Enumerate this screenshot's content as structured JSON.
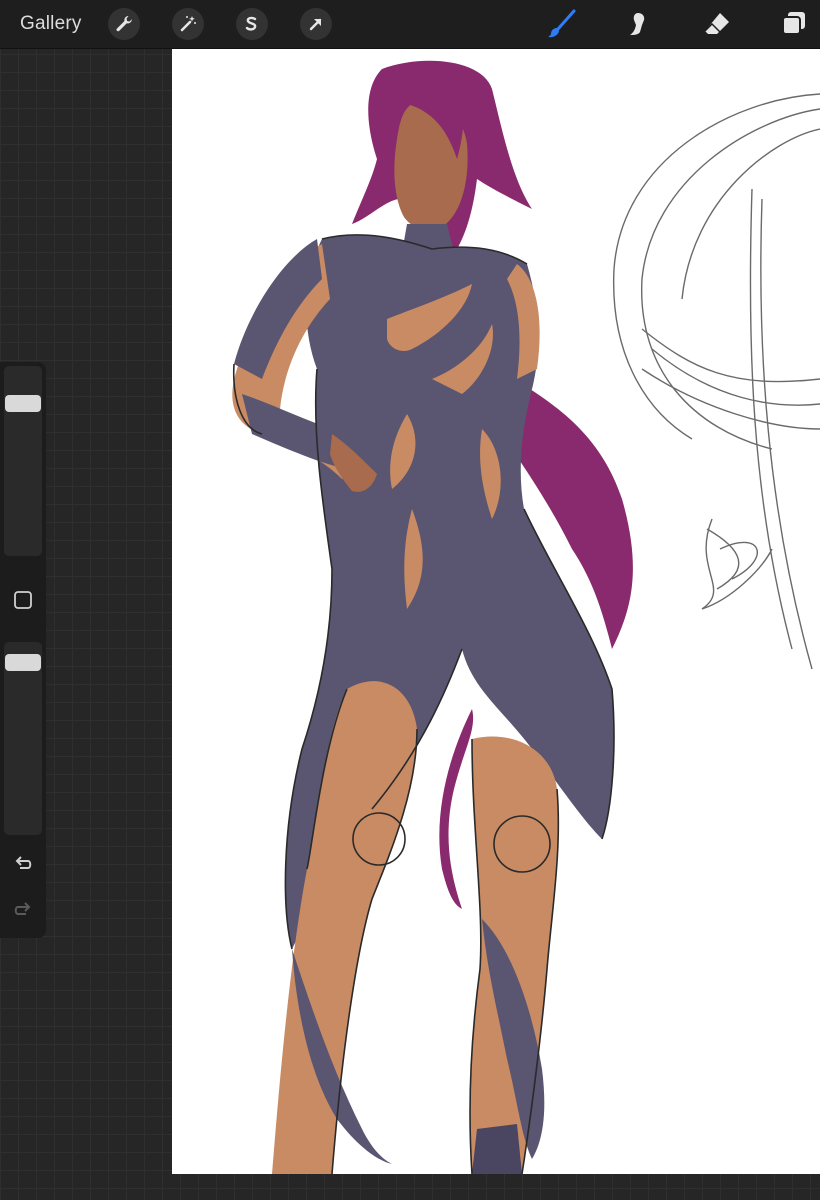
{
  "toolbar": {
    "gallery_label": "Gallery",
    "left_tools": [
      "wrench-icon",
      "magic-wand-icon",
      "selection-icon",
      "transform-arrow-icon"
    ],
    "right_tools": [
      "brush-icon",
      "smudge-icon",
      "eraser-icon",
      "layers-icon"
    ],
    "active_tool": "brush-icon",
    "accent_color": "#2f7df6"
  },
  "sidebar": {
    "brush_size": 0.83,
    "brush_opacity": 0.93,
    "modify_button": "square-icon",
    "undo": "undo-icon",
    "redo": "redo-icon"
  },
  "canvas": {
    "artwork": "character-sketch",
    "colors": {
      "hair": "#8a2a6e",
      "outfit": "#5a5570",
      "skin": "#c98b63",
      "line": "#2a2a2a",
      "sketch": "#6a6a6a"
    }
  }
}
